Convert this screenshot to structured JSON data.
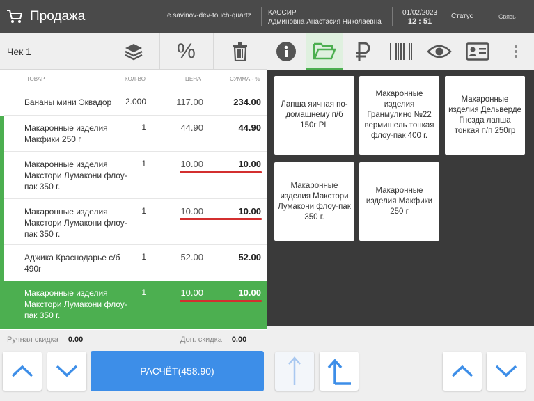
{
  "header": {
    "title": "Продажа",
    "host": "e.savinov-dev-touch-quartz",
    "cashier_label": "КАССИР",
    "cashier_name": "Админовна Анастасия Николаевна",
    "date": "01/02/2023",
    "time": "12 : 51",
    "status": "Статус",
    "link": "Связь"
  },
  "toolbar": {
    "check_label": "Чек 1",
    "percent_label": "%"
  },
  "columns": {
    "product": "ТОВАР",
    "qty": "КОЛ-ВО",
    "price": "ЦЕНА",
    "sum": "СУММА - %"
  },
  "items": [
    {
      "name": "Бананы мини Эквадор",
      "qty": "2.000",
      "price": "117.00",
      "sum": "234.00"
    },
    {
      "name": "Макаронные изделия Макфики 250 г",
      "qty": "1",
      "price": "44.90",
      "sum": "44.90"
    },
    {
      "name": "Макаронные изделия Макстори Лумакони флоу-пак 350 г.",
      "qty": "1",
      "price": "10.00",
      "sum": "10.00"
    },
    {
      "name": "Макаронные изделия Макстори Лумакони флоу-пак 350 г.",
      "qty": "1",
      "price": "10.00",
      "sum": "10.00"
    },
    {
      "name": "Аджика Краснодарье с/б 490г",
      "qty": "1",
      "price": "52.00",
      "sum": "52.00"
    },
    {
      "name": "Макаронные изделия Макстори Лумакони флоу-пак 350 г.",
      "qty": "1",
      "price": "10.00",
      "sum": "10.00"
    }
  ],
  "discounts": {
    "manual_label": "Ручная скидка",
    "manual_value": "0.00",
    "extra_label": "Доп. скидка",
    "extra_value": "0.00"
  },
  "pay_label": "РАСЧЁТ(458.90)",
  "products": [
    "Лапша яичная по-домашнему п/б 150г PL",
    "Макаронные изделия Гранмулино №22 вермишель тонкая флоу-пак 400 г.",
    "Макаронные изделия Дельверде Гнезда лапша тонкая п/п 250гр",
    "Макаронные изделия Макстори Лумакони флоу-пак 350 г.",
    "Макаронные изделия Макфики 250 г"
  ],
  "colors": {
    "accent": "#3d8ee8",
    "selected": "#4caf50",
    "underline": "#d32f2f",
    "header": "#4a4a4a"
  }
}
